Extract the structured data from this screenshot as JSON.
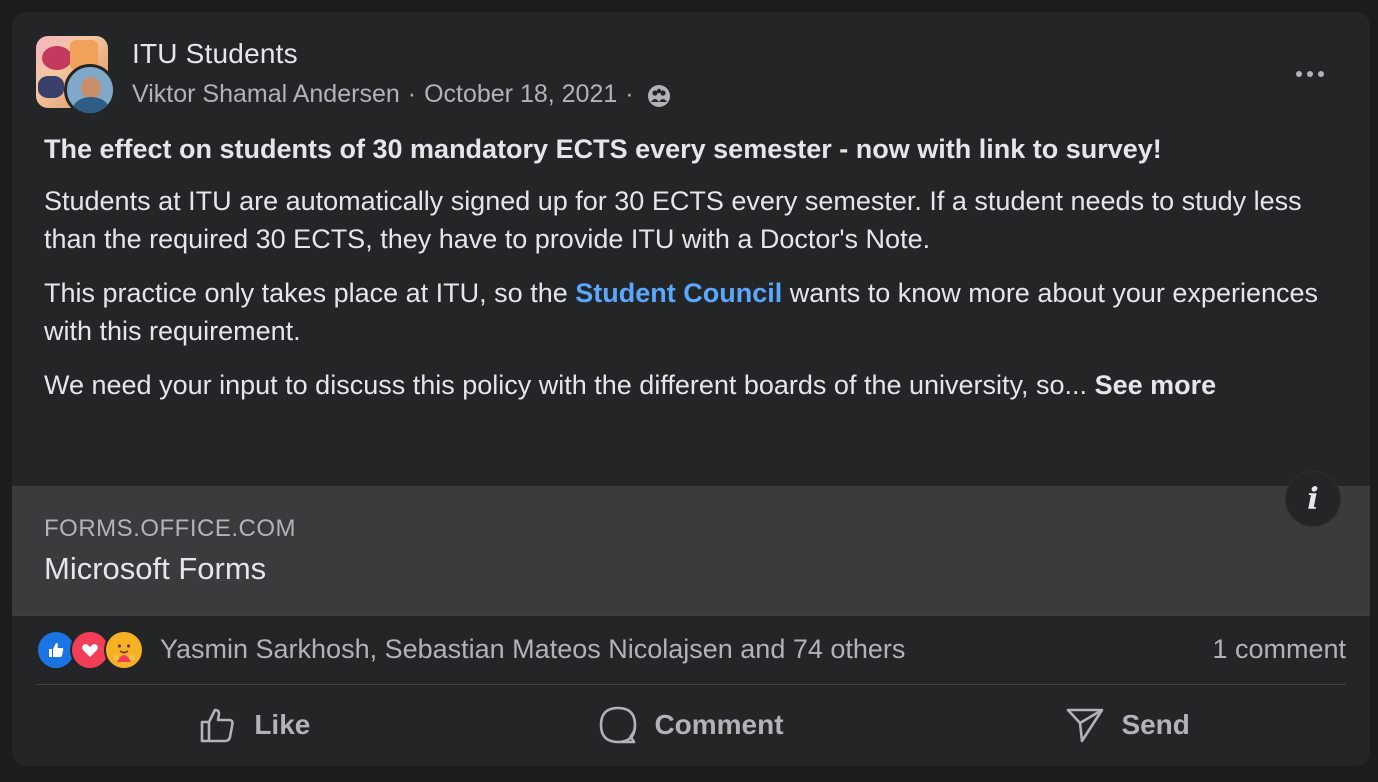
{
  "header": {
    "group_name": "ITU Students",
    "author": "Viktor Shamal Andersen",
    "separator": "·",
    "date": "October 18, 2021",
    "privacy_icon": "group-members-icon"
  },
  "body": {
    "title": "The effect on students of 30 mandatory ECTS every semester - now with link to survey!",
    "paragraph1": "Students at ITU are automatically signed up for 30 ECTS every semester. If a student needs to study less than the required 30 ECTS, they have to provide ITU with a Doctor's Note.",
    "paragraph2_before": "This practice only takes place at ITU, so the ",
    "paragraph2_link": "Student Council",
    "paragraph2_after": " wants to know more about your experiences with this requirement.",
    "paragraph3": "We need your input to discuss this policy with the different boards of the university, so... ",
    "see_more": "See more"
  },
  "preview": {
    "domain": "FORMS.OFFICE.COM",
    "title": "Microsoft Forms",
    "info_label": "i"
  },
  "reactions": {
    "types": [
      "like",
      "love",
      "care"
    ],
    "summary": "Yasmin Sarkhosh, Sebastian Mateos Nicolajsen and 74 others",
    "comments": "1 comment"
  },
  "actions": {
    "like": "Like",
    "comment": "Comment",
    "send": "Send"
  },
  "colors": {
    "background": "#242526",
    "link": "#5aa7ff",
    "like": "#1b74e4",
    "love": "#f33e58",
    "care": "#f7b125"
  }
}
